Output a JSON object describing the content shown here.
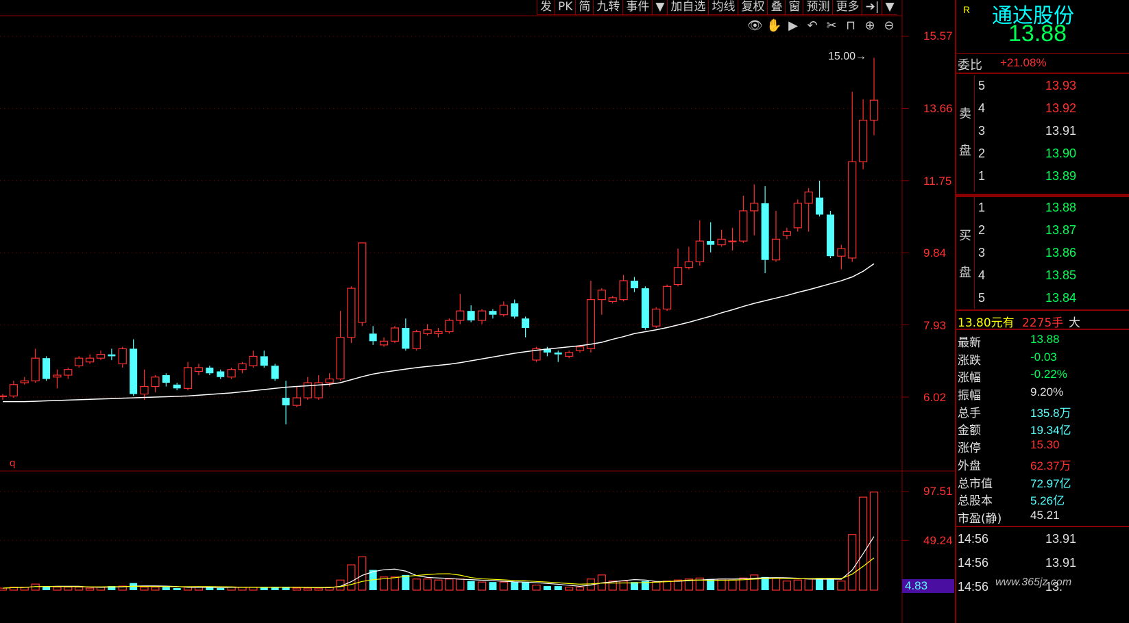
{
  "toolbar": {
    "items": [
      "发",
      "PK",
      "简",
      "九转",
      "事件",
      "▼",
      "加自选",
      "均线",
      "复权",
      "叠",
      "窗",
      "预测",
      "更多",
      "➔|",
      "▼"
    ]
  },
  "tools": [
    "eye-icon",
    "hand-icon",
    "play-icon",
    "undo-icon",
    "scissors-icon",
    "lock-icon",
    "zoom-in-icon",
    "zoom-out-icon"
  ],
  "price_axis": [
    "15.57",
    "13.66",
    "11.75",
    "9.84",
    "7.93",
    "6.02"
  ],
  "volume_axis": [
    "97.51",
    "49.24"
  ],
  "high_marker": "15.00",
  "period_label": "q",
  "volume_ma_value": "4.83",
  "colors": {
    "up": "#ff3030",
    "down": "#54ffff",
    "ma_white": "#ffffff",
    "ma_yellow": "#ffff00",
    "grid": "#8a0000"
  },
  "stock": {
    "mark": "R",
    "name": "通达股份",
    "price": "13.88"
  },
  "order_ratio": {
    "label": "委比",
    "value": "+21.08%"
  },
  "sell_book": {
    "side_label_1": "卖",
    "side_label_2": "盘",
    "rows": [
      {
        "level": "5",
        "price": "13.93",
        "color": "#ff3030"
      },
      {
        "level": "4",
        "price": "13.92",
        "color": "#ff3030"
      },
      {
        "level": "3",
        "price": "13.91",
        "color": "#e0e0e0"
      },
      {
        "level": "2",
        "price": "13.90",
        "color": "#00ff55"
      },
      {
        "level": "1",
        "price": "13.89",
        "color": "#00ff55"
      }
    ]
  },
  "buy_book": {
    "side_label_1": "买",
    "side_label_2": "盘",
    "rows": [
      {
        "level": "1",
        "price": "13.88",
        "color": "#00ff55"
      },
      {
        "level": "2",
        "price": "13.87",
        "color": "#00ff55"
      },
      {
        "level": "3",
        "price": "13.86",
        "color": "#00ff55"
      },
      {
        "level": "4",
        "price": "13.85",
        "color": "#00ff55"
      },
      {
        "level": "5",
        "price": "13.84",
        "color": "#00ff55"
      }
    ]
  },
  "large_order": {
    "price_text": "13.80元有",
    "volume_text": "2275手",
    "suffix": "大"
  },
  "stats": [
    {
      "key": "最新",
      "value": "13.88",
      "color": "#00ff55"
    },
    {
      "key": "涨跌",
      "value": "-0.03",
      "color": "#00ff55"
    },
    {
      "key": "涨幅",
      "value": "-0.22%",
      "color": "#00ff55"
    },
    {
      "key": "振幅",
      "value": "9.20%",
      "color": "#e0e0e0"
    },
    {
      "key": "总手",
      "value": "135.8万",
      "color": "#54ffff"
    },
    {
      "key": "金额",
      "value": "19.34亿",
      "color": "#54ffff"
    },
    {
      "key": "涨停",
      "value": "15.30",
      "color": "#ff3030"
    },
    {
      "key": "外盘",
      "value": "62.37万",
      "color": "#ff3030"
    },
    {
      "key": "总市值",
      "value": "72.97亿",
      "color": "#54ffff"
    },
    {
      "key": "总股本",
      "value": "5.26亿",
      "color": "#54ffff"
    },
    {
      "key": "市盈(静)",
      "value": "45.21",
      "color": "#e0e0e0"
    }
  ],
  "ticks": [
    {
      "time": "14:56",
      "price": "13.91"
    },
    {
      "time": "14:56",
      "price": "13.91"
    },
    {
      "time": "14:56",
      "price": "13."
    }
  ],
  "watermark": "www.365jz.com",
  "chart_data": {
    "type": "candlestick",
    "y_axis_ticks": [
      15.57,
      13.66,
      11.75,
      9.84,
      7.93,
      6.02
    ],
    "ylim": [
      3.3,
      16.6
    ],
    "high_marker": 15.0,
    "candles": [
      {
        "o": 6.05,
        "c": 6.05,
        "h": 6.1,
        "l": 5.95,
        "v": 2
      },
      {
        "o": 6.05,
        "c": 6.35,
        "h": 6.45,
        "l": 6.0,
        "v": 3
      },
      {
        "o": 6.4,
        "c": 6.45,
        "h": 6.55,
        "l": 6.35,
        "v": 3
      },
      {
        "o": 6.45,
        "c": 7.05,
        "h": 7.3,
        "l": 6.4,
        "v": 6
      },
      {
        "o": 7.05,
        "c": 6.5,
        "h": 7.1,
        "l": 6.45,
        "v": 4
      },
      {
        "o": 6.55,
        "c": 6.6,
        "h": 6.75,
        "l": 6.25,
        "v": 3
      },
      {
        "o": 6.6,
        "c": 6.75,
        "h": 6.8,
        "l": 6.5,
        "v": 3
      },
      {
        "o": 6.85,
        "c": 7.05,
        "h": 7.1,
        "l": 6.8,
        "v": 3
      },
      {
        "o": 6.95,
        "c": 7.05,
        "h": 7.15,
        "l": 6.9,
        "v": 2
      },
      {
        "o": 7.05,
        "c": 7.15,
        "h": 7.25,
        "l": 7.0,
        "v": 3
      },
      {
        "o": 7.15,
        "c": 7.1,
        "h": 7.3,
        "l": 7.0,
        "v": 4
      },
      {
        "o": 6.9,
        "c": 7.3,
        "h": 7.35,
        "l": 6.8,
        "v": 4
      },
      {
        "o": 7.3,
        "c": 6.1,
        "h": 7.55,
        "l": 6.05,
        "v": 7
      },
      {
        "o": 6.1,
        "c": 6.3,
        "h": 6.75,
        "l": 5.95,
        "v": 3
      },
      {
        "o": 6.3,
        "c": 6.55,
        "h": 6.6,
        "l": 6.15,
        "v": 3
      },
      {
        "o": 6.6,
        "c": 6.4,
        "h": 6.65,
        "l": 6.3,
        "v": 3
      },
      {
        "o": 6.35,
        "c": 6.25,
        "h": 6.4,
        "l": 6.2,
        "v": 2
      },
      {
        "o": 6.25,
        "c": 6.8,
        "h": 6.95,
        "l": 6.2,
        "v": 3
      },
      {
        "o": 6.7,
        "c": 6.8,
        "h": 6.9,
        "l": 6.6,
        "v": 3
      },
      {
        "o": 6.8,
        "c": 6.65,
        "h": 6.85,
        "l": 6.6,
        "v": 3
      },
      {
        "o": 6.7,
        "c": 6.55,
        "h": 6.75,
        "l": 6.5,
        "v": 2
      },
      {
        "o": 6.55,
        "c": 6.75,
        "h": 6.8,
        "l": 6.5,
        "v": 3
      },
      {
        "o": 6.75,
        "c": 6.9,
        "h": 6.95,
        "l": 6.65,
        "v": 3
      },
      {
        "o": 6.85,
        "c": 7.1,
        "h": 7.25,
        "l": 6.8,
        "v": 3
      },
      {
        "o": 7.1,
        "c": 6.85,
        "h": 7.25,
        "l": 6.8,
        "v": 3
      },
      {
        "o": 6.85,
        "c": 6.5,
        "h": 6.9,
        "l": 6.45,
        "v": 3
      },
      {
        "o": 6.0,
        "c": 5.8,
        "h": 6.45,
        "l": 5.3,
        "v": 3
      },
      {
        "o": 5.8,
        "c": 6.0,
        "h": 6.3,
        "l": 5.75,
        "v": 2
      },
      {
        "o": 6.0,
        "c": 6.4,
        "h": 6.55,
        "l": 5.95,
        "v": 2
      },
      {
        "o": 6.0,
        "c": 6.4,
        "h": 6.6,
        "l": 5.95,
        "v": 2
      },
      {
        "o": 6.4,
        "c": 6.5,
        "h": 6.65,
        "l": 6.3,
        "v": 3
      },
      {
        "o": 6.5,
        "c": 7.6,
        "h": 8.3,
        "l": 6.45,
        "v": 10
      },
      {
        "o": 7.6,
        "c": 8.9,
        "h": 8.95,
        "l": 7.45,
        "v": 25
      },
      {
        "o": 8.0,
        "c": 10.1,
        "h": 10.1,
        "l": 7.9,
        "v": 33
      },
      {
        "o": 7.7,
        "c": 7.5,
        "h": 7.9,
        "l": 7.4,
        "v": 20
      },
      {
        "o": 7.4,
        "c": 7.5,
        "h": 7.6,
        "l": 7.35,
        "v": 13
      },
      {
        "o": 7.5,
        "c": 7.85,
        "h": 7.9,
        "l": 7.45,
        "v": 13
      },
      {
        "o": 7.85,
        "c": 7.3,
        "h": 8.1,
        "l": 7.25,
        "v": 15
      },
      {
        "o": 7.3,
        "c": 7.75,
        "h": 7.8,
        "l": 7.25,
        "v": 11
      },
      {
        "o": 7.7,
        "c": 7.8,
        "h": 7.95,
        "l": 7.65,
        "v": 11
      },
      {
        "o": 7.7,
        "c": 7.75,
        "h": 7.85,
        "l": 7.6,
        "v": 10
      },
      {
        "o": 7.75,
        "c": 8.05,
        "h": 8.1,
        "l": 7.7,
        "v": 11
      },
      {
        "o": 8.05,
        "c": 8.3,
        "h": 8.75,
        "l": 7.95,
        "v": 11
      },
      {
        "o": 8.3,
        "c": 8.05,
        "h": 8.45,
        "l": 8.0,
        "v": 9
      },
      {
        "o": 8.05,
        "c": 8.3,
        "h": 8.35,
        "l": 7.95,
        "v": 8
      },
      {
        "o": 8.3,
        "c": 8.2,
        "h": 8.35,
        "l": 8.1,
        "v": 8
      },
      {
        "o": 8.2,
        "c": 8.45,
        "h": 8.55,
        "l": 8.15,
        "v": 8
      },
      {
        "o": 8.5,
        "c": 8.15,
        "h": 8.6,
        "l": 8.1,
        "v": 8
      },
      {
        "o": 8.1,
        "c": 7.85,
        "h": 8.15,
        "l": 7.6,
        "v": 8
      },
      {
        "o": 7.0,
        "c": 7.3,
        "h": 7.35,
        "l": 6.95,
        "v": 5
      },
      {
        "o": 7.3,
        "c": 7.2,
        "h": 7.35,
        "l": 7.1,
        "v": 4
      },
      {
        "o": 7.2,
        "c": 7.15,
        "h": 7.25,
        "l": 6.95,
        "v": 4
      },
      {
        "o": 7.1,
        "c": 7.2,
        "h": 7.25,
        "l": 7.05,
        "v": 3
      },
      {
        "o": 7.25,
        "c": 7.35,
        "h": 7.4,
        "l": 7.2,
        "v": 3
      },
      {
        "o": 7.3,
        "c": 8.6,
        "h": 9.1,
        "l": 7.2,
        "v": 11
      },
      {
        "o": 8.6,
        "c": 8.85,
        "h": 8.9,
        "l": 8.2,
        "v": 15
      },
      {
        "o": 8.55,
        "c": 8.65,
        "h": 8.7,
        "l": 8.5,
        "v": 9
      },
      {
        "o": 8.6,
        "c": 9.1,
        "h": 9.25,
        "l": 8.55,
        "v": 9
      },
      {
        "o": 9.1,
        "c": 8.9,
        "h": 9.2,
        "l": 8.8,
        "v": 8
      },
      {
        "o": 8.9,
        "c": 7.85,
        "h": 8.95,
        "l": 7.8,
        "v": 9
      },
      {
        "o": 7.9,
        "c": 8.35,
        "h": 8.4,
        "l": 7.85,
        "v": 8
      },
      {
        "o": 8.35,
        "c": 8.95,
        "h": 9.0,
        "l": 8.3,
        "v": 9
      },
      {
        "o": 9.0,
        "c": 9.45,
        "h": 9.95,
        "l": 8.95,
        "v": 10
      },
      {
        "o": 9.45,
        "c": 9.6,
        "h": 10.0,
        "l": 9.4,
        "v": 11
      },
      {
        "o": 9.6,
        "c": 10.15,
        "h": 10.7,
        "l": 9.5,
        "v": 12
      },
      {
        "o": 10.15,
        "c": 10.05,
        "h": 10.65,
        "l": 9.85,
        "v": 11
      },
      {
        "o": 10.05,
        "c": 10.2,
        "h": 10.45,
        "l": 10.0,
        "v": 11
      },
      {
        "o": 10.15,
        "c": 10.15,
        "h": 10.5,
        "l": 9.9,
        "v": 10
      },
      {
        "o": 10.15,
        "c": 10.95,
        "h": 11.35,
        "l": 10.1,
        "v": 12
      },
      {
        "o": 10.95,
        "c": 11.15,
        "h": 11.65,
        "l": 10.3,
        "v": 15
      },
      {
        "o": 11.15,
        "c": 9.65,
        "h": 11.6,
        "l": 9.3,
        "v": 13
      },
      {
        "o": 9.65,
        "c": 10.2,
        "h": 10.95,
        "l": 9.6,
        "v": 12
      },
      {
        "o": 10.3,
        "c": 10.4,
        "h": 10.5,
        "l": 10.2,
        "v": 9
      },
      {
        "o": 10.5,
        "c": 11.15,
        "h": 11.25,
        "l": 10.4,
        "v": 10
      },
      {
        "o": 11.15,
        "c": 11.45,
        "h": 11.55,
        "l": 10.4,
        "v": 11
      },
      {
        "o": 11.3,
        "c": 10.85,
        "h": 11.75,
        "l": 10.8,
        "v": 12
      },
      {
        "o": 10.85,
        "c": 9.75,
        "h": 10.95,
        "l": 9.7,
        "v": 12
      },
      {
        "o": 9.75,
        "c": 9.95,
        "h": 10.05,
        "l": 9.4,
        "v": 9
      },
      {
        "o": 9.7,
        "c": 12.25,
        "h": 14.1,
        "l": 9.6,
        "v": 55
      },
      {
        "o": 12.25,
        "c": 13.35,
        "h": 13.9,
        "l": 12.05,
        "v": 92
      },
      {
        "o": 13.35,
        "c": 13.88,
        "h": 15.0,
        "l": 12.95,
        "v": 97
      }
    ],
    "ma_price": [
      5.9,
      5.9,
      5.9,
      5.91,
      5.92,
      5.93,
      5.94,
      5.95,
      5.96,
      5.97,
      5.98,
      5.99,
      6.0,
      6.01,
      6.02,
      6.03,
      6.04,
      6.05,
      6.07,
      6.09,
      6.11,
      6.13,
      6.16,
      6.19,
      6.22,
      6.25,
      6.28,
      6.3,
      6.32,
      6.34,
      6.36,
      6.4,
      6.48,
      6.56,
      6.63,
      6.68,
      6.72,
      6.76,
      6.8,
      6.83,
      6.86,
      6.89,
      6.93,
      6.98,
      7.03,
      7.08,
      7.13,
      7.18,
      7.22,
      7.26,
      7.29,
      7.32,
      7.35,
      7.38,
      7.42,
      7.47,
      7.55,
      7.62,
      7.7,
      7.75,
      7.8,
      7.86,
      7.93,
      8.0,
      8.08,
      8.16,
      8.25,
      8.33,
      8.42,
      8.5,
      8.57,
      8.64,
      8.71,
      8.79,
      8.86,
      8.94,
      9.02,
      9.1,
      9.2,
      9.35,
      9.55
    ],
    "volume_ma_value": 4.83,
    "volume_axis_ticks": [
      97.51,
      49.24
    ]
  }
}
